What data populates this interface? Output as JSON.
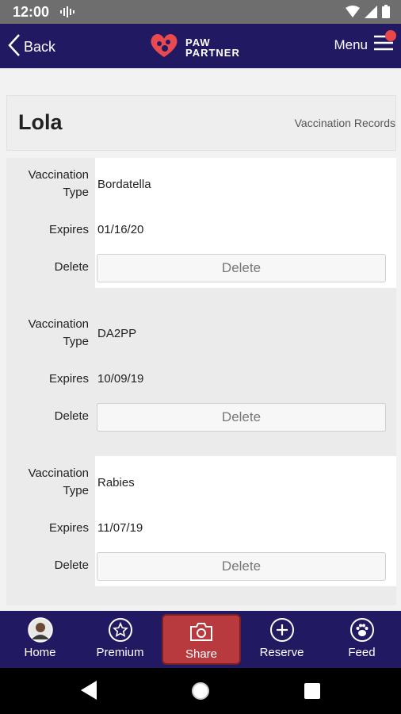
{
  "status_bar": {
    "time": "12:00",
    "icons": [
      "voicemail-icon",
      "wifi-icon",
      "signal-icon",
      "battery-icon"
    ]
  },
  "header": {
    "back_label": "Back",
    "brand_line1": "PAW",
    "brand_line2": "PARTNER",
    "menu_label": "Menu",
    "menu_badge_color": "#e8484c",
    "bg_color": "#211a63"
  },
  "pet": {
    "name": "Lola",
    "section": "Vaccination Records"
  },
  "labels": {
    "vaccination_type_line1": "Vaccination",
    "vaccination_type_line2": "Type",
    "expires": "Expires",
    "delete": "Delete"
  },
  "records": [
    {
      "type": "Bordatella",
      "expires": "01/16/20",
      "delete_button": "Delete"
    },
    {
      "type": "DA2PP",
      "expires": "10/09/19",
      "delete_button": "Delete"
    },
    {
      "type": "Rabies",
      "expires": "11/07/19",
      "delete_button": "Delete"
    }
  ],
  "bottom_nav": {
    "items": [
      {
        "label": "Home",
        "icon": "avatar-icon"
      },
      {
        "label": "Premium",
        "icon": "star-icon"
      },
      {
        "label": "Share",
        "icon": "camera-icon",
        "active": true
      },
      {
        "label": "Reserve",
        "icon": "plus-circle-icon"
      },
      {
        "label": "Feed",
        "icon": "paw-icon"
      }
    ],
    "active_color": "#b83a3e"
  }
}
